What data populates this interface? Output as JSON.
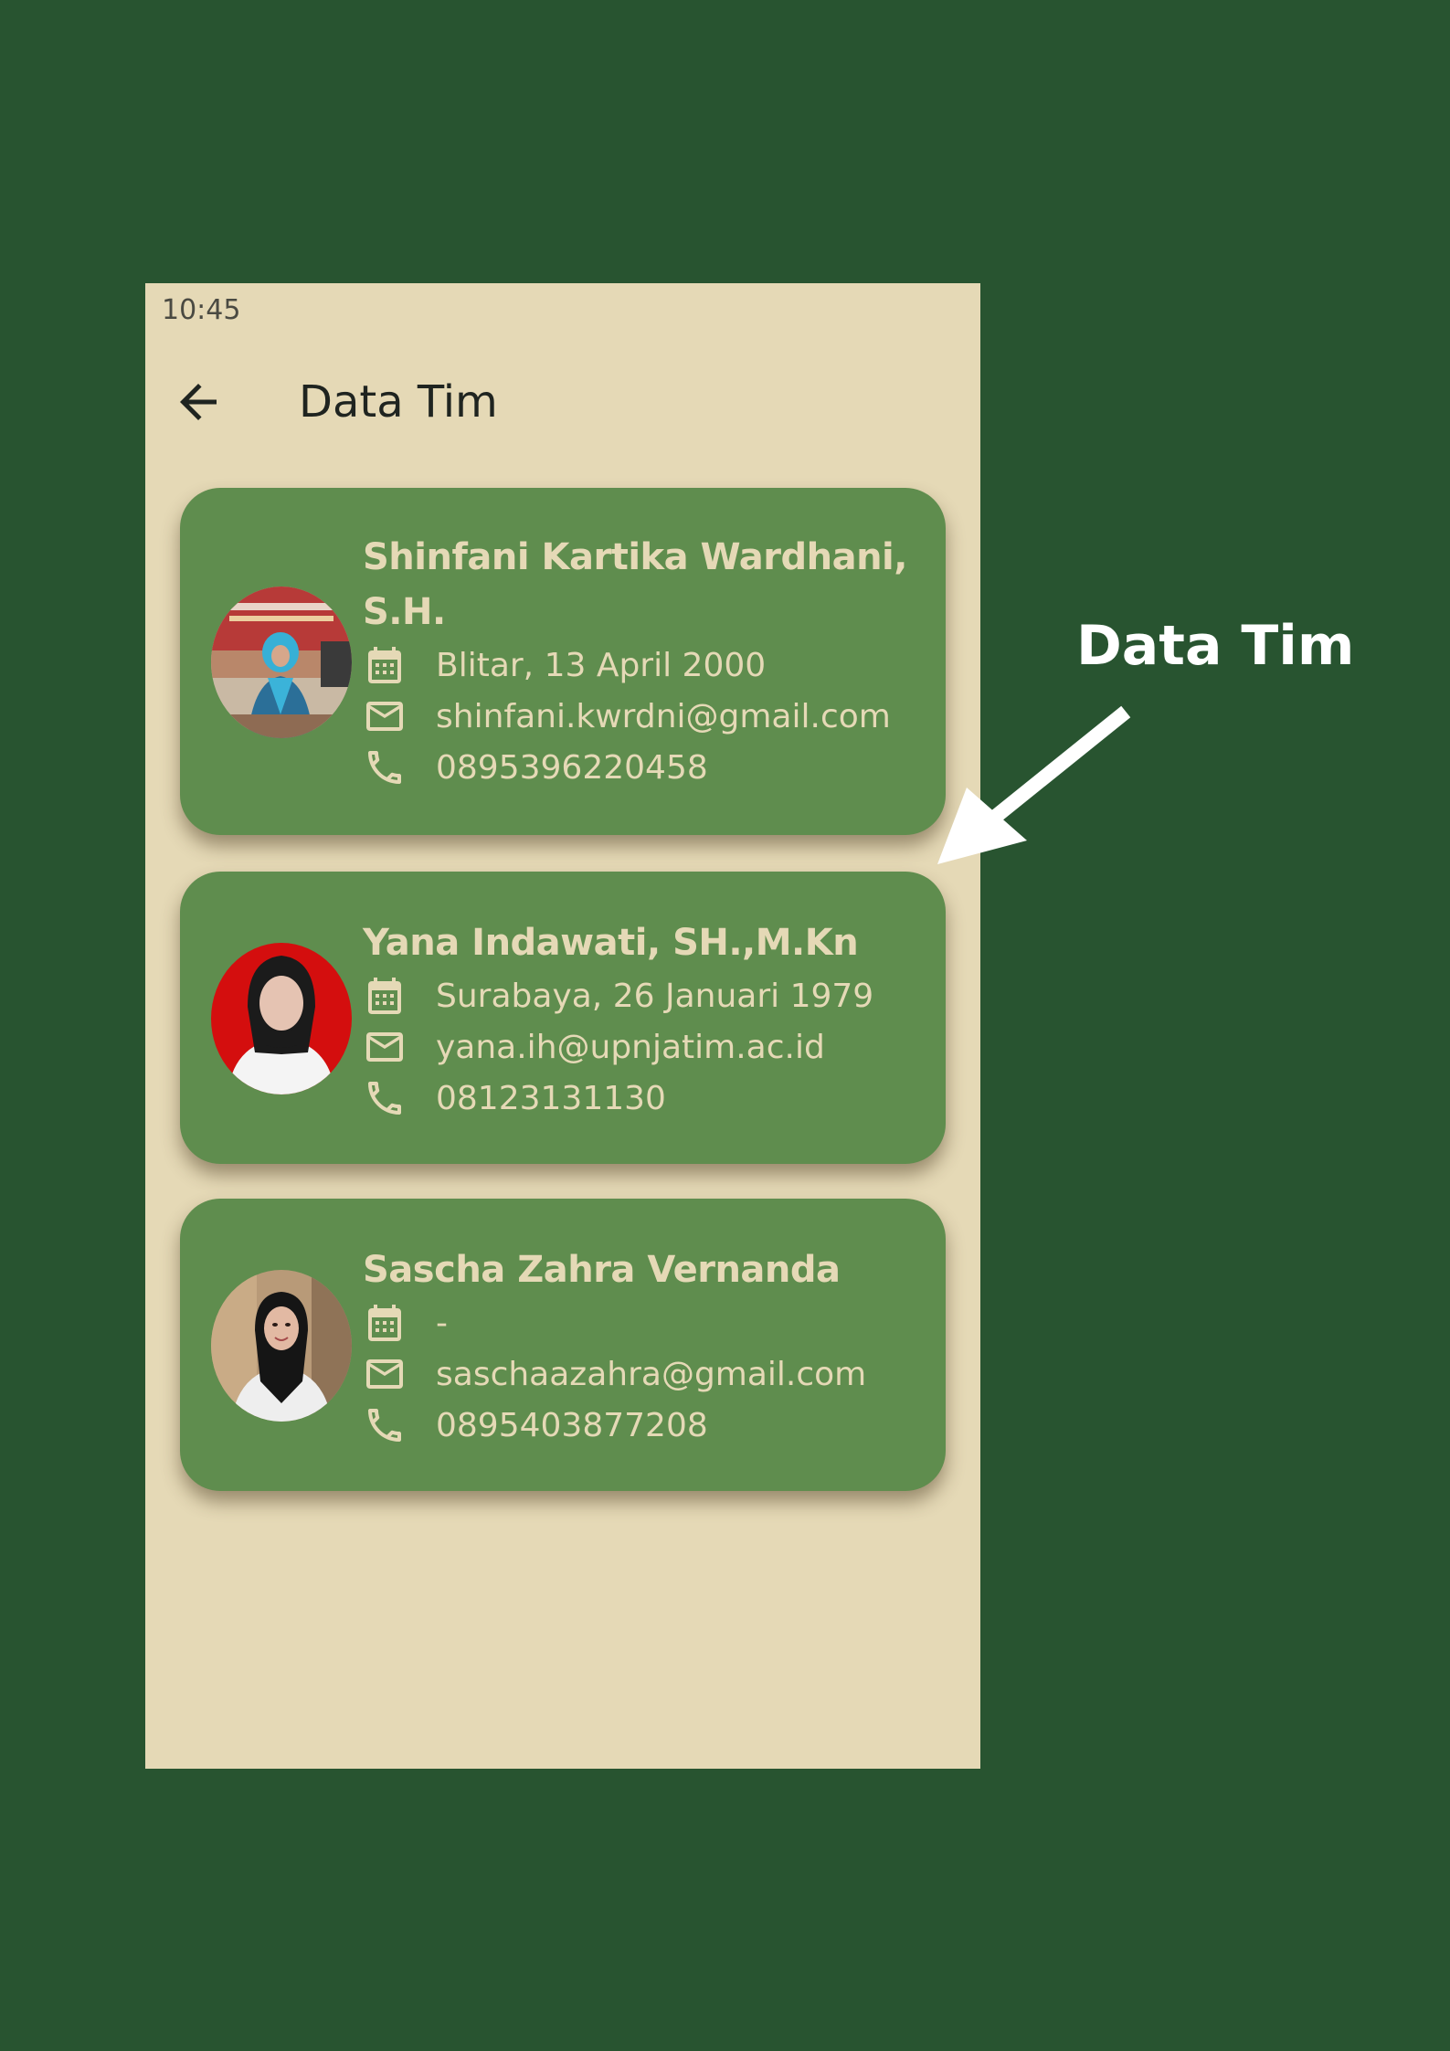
{
  "status_bar": {
    "time": "10:45"
  },
  "app_bar": {
    "title": "Data Tim",
    "back_icon": "arrow-left-icon"
  },
  "colors": {
    "outer_background": "#285430",
    "screen_background": "#e5d9b6",
    "card_background": "#5f8d4e",
    "card_text": "#e5d9b6"
  },
  "team": [
    {
      "name": "Shinfani Kartika Wardhani,\nS.H.",
      "birth": "Blitar, 13 April 2000",
      "email": "shinfani.kwrdni@gmail.com",
      "phone": "0895396220458"
    },
    {
      "name": "Yana Indawati, SH.,M.Kn",
      "birth": "Surabaya, 26 Januari 1979",
      "email": "yana.ih@upnjatim.ac.id",
      "phone": "08123131130"
    },
    {
      "name": "Sascha Zahra Vernanda",
      "birth": "-",
      "email": "saschaazahra@gmail.com",
      "phone": "0895403877208"
    }
  ],
  "icons": {
    "birth": "calendar-icon",
    "email": "mail-icon",
    "phone": "phone-icon"
  },
  "annotation": {
    "label": "Data Tim"
  }
}
